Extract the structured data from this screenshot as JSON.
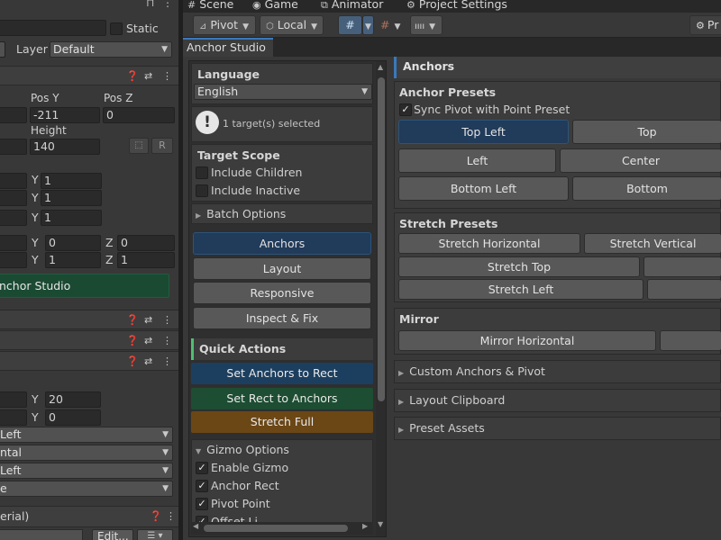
{
  "left": {
    "static_label": "Static",
    "layer_label": "Layer",
    "layer_value": "Default",
    "pos_y_label": "Pos Y",
    "pos_z_label": "Pos Z",
    "pos_y_value": "-211",
    "pos_z_value": "0",
    "height_label": "Height",
    "height_value": "140",
    "r_label": "R",
    "y_label": "Y",
    "z_label": "Z",
    "rows": [
      {
        "y": "1"
      },
      {
        "y": "1"
      },
      {
        "y": "1"
      }
    ],
    "pivot_row": {
      "y": "0",
      "z": "0"
    },
    "scale_row": {
      "y": "1",
      "z": "1"
    },
    "anchor_studio_button": "nchor Studio",
    "spacing_row1_y": "20",
    "spacing_row2_y": "0",
    "dropdowns": [
      "Left",
      "ntal",
      "Left",
      "e"
    ],
    "material_label": "erial)",
    "edit_button": "Edit..."
  },
  "scene_tabs": [
    {
      "label": "Scene",
      "icon": "scene-icon"
    },
    {
      "label": "Game",
      "icon": "game-icon"
    },
    {
      "label": "Animator",
      "icon": "animator-icon"
    },
    {
      "label": "Project Settings",
      "icon": "gear-icon"
    }
  ],
  "toolbar": {
    "pivot": "Pivot",
    "local": "Local",
    "right_label": "Pr"
  },
  "window_tab": "Anchor Studio",
  "nav": {
    "language_title": "Language",
    "language_value": "English",
    "selection_info": "1 target(s) selected",
    "target_scope_title": "Target Scope",
    "include_children": "Include Children",
    "include_inactive": "Include Inactive",
    "batch_options": "Batch Options",
    "menu": [
      "Anchors",
      "Layout",
      "Responsive",
      "Inspect & Fix"
    ],
    "quick_actions_title": "Quick Actions",
    "quick_actions": [
      {
        "label": "Set Anchors to Rect",
        "color": "#1d3f5f"
      },
      {
        "label": "Set Rect to Anchors",
        "color": "#1d4d32"
      },
      {
        "label": "Stretch Full",
        "color": "#6b4716"
      }
    ],
    "gizmo_title": "Gizmo Options",
    "gizmo_items": [
      "Enable Gizmo",
      "Anchor Rect",
      "Pivot Point"
    ],
    "gizmo_partial": "Offset Li..."
  },
  "content": {
    "header": "Anchors",
    "anchor_presets_title": "Anchor Presets",
    "sync_pivot": "Sync Pivot with Point Preset",
    "anchor_presets": [
      "Top Left",
      "Top",
      "Left",
      "Center",
      "Bottom Left",
      "Bottom"
    ],
    "stretch_presets_title": "Stretch Presets",
    "stretch_presets": [
      "Stretch Horizontal",
      "Stretch Vertical",
      "Stretch Top",
      "",
      "Stretch Left",
      ""
    ],
    "mirror_title": "Mirror",
    "mirror_buttons": [
      "Mirror Horizontal",
      ""
    ],
    "foldouts": [
      "Custom Anchors & Pivot",
      "Layout Clipboard",
      "Preset Assets"
    ]
  },
  "colors": {
    "accent_blue": "#3a79bb",
    "selected_button": "#213b5a",
    "quick_blue": "#1d3f5f",
    "quick_green": "#1d4d32",
    "quick_orange": "#6b4716",
    "anchor_studio_green": "#1b4a33"
  }
}
